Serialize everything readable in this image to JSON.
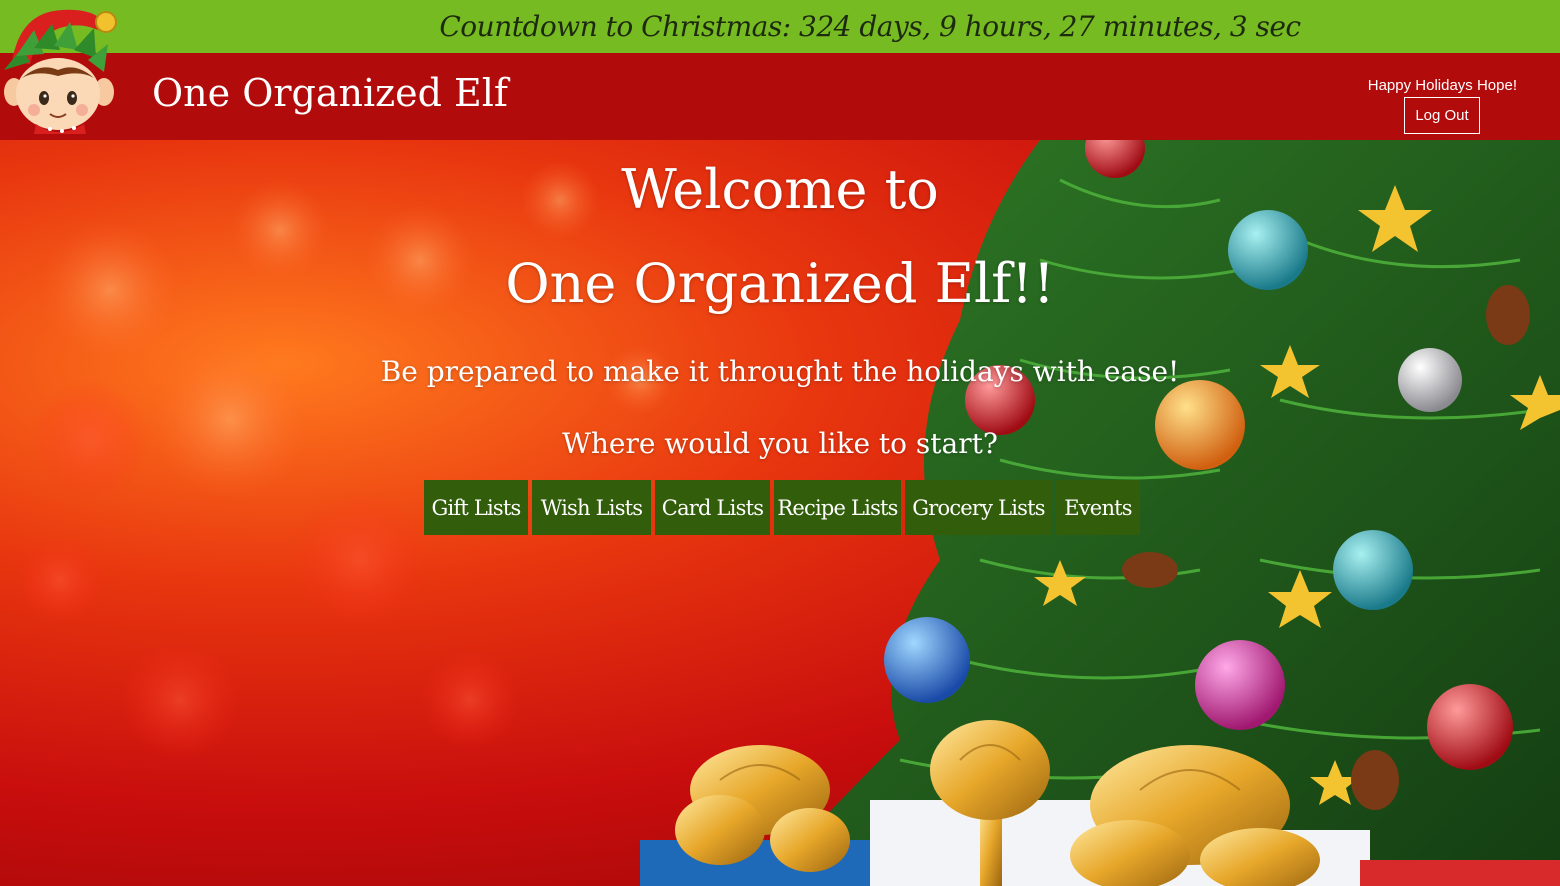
{
  "countdown": {
    "text": "Countdown to Christmas: 324 days, 9 hours, 27 minutes, 3 sec"
  },
  "header": {
    "title": "One Organized Elf",
    "greeting": "Happy Holidays Hope!",
    "logout_label": "Log Out"
  },
  "hero": {
    "welcome_line1": "Welcome to",
    "welcome_line2": "One Organized Elf!!",
    "tagline": "Be prepared to make it throught the holidays with ease!",
    "prompt": "Where would you like to start?"
  },
  "nav": {
    "buttons": [
      {
        "label": "Gift Lists"
      },
      {
        "label": "Wish Lists"
      },
      {
        "label": "Card Lists"
      },
      {
        "label": "Recipe Lists"
      },
      {
        "label": "Grocery Lists"
      },
      {
        "label": "Events"
      }
    ]
  },
  "colors": {
    "countdown_bar": "#76bb22",
    "header": "#b20b0b",
    "nav_button": "#325d0b"
  },
  "icons": {
    "logo": "elf-icon"
  }
}
